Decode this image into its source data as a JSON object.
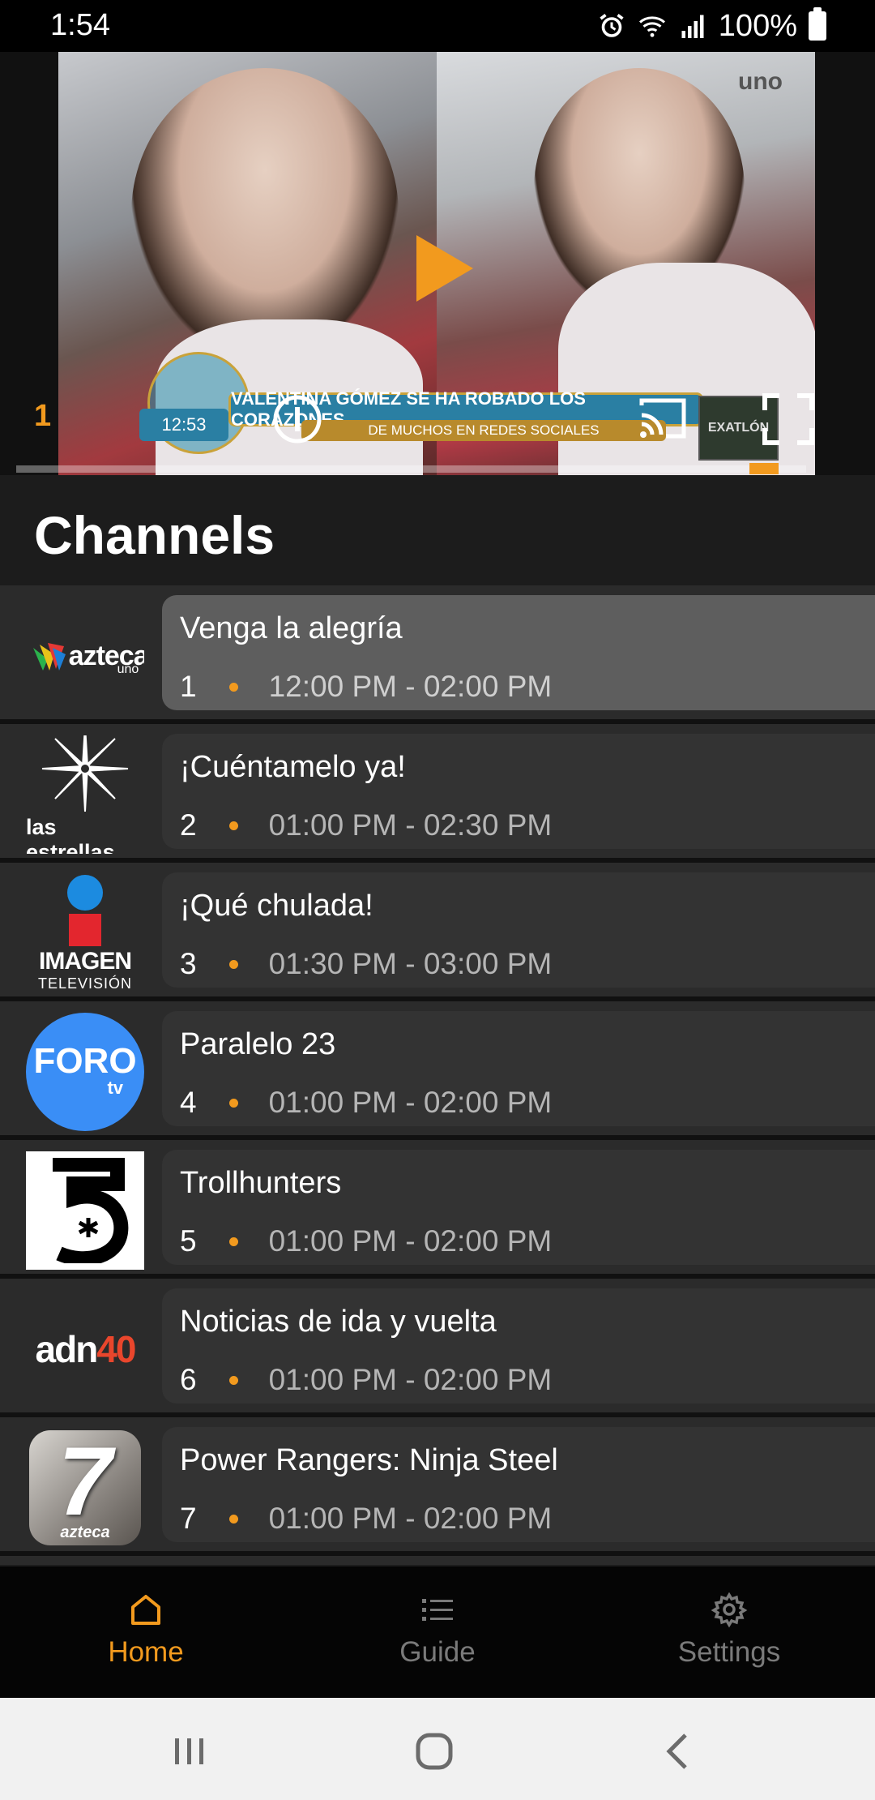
{
  "status_bar": {
    "time": "1:54",
    "battery_percent": "100%",
    "icons": [
      "alarm-icon",
      "wifi-icon",
      "signal-icon",
      "battery-icon"
    ]
  },
  "player": {
    "current_channel_number": "1",
    "progress": 0.965,
    "accent_color": "#f29a1e",
    "video_overlays": {
      "banner": "VALENTINA GÓMEZ SE HA ROBADO LOS CORAZONES",
      "banner_sub": "DE MUCHOS EN REDES SOCIALES",
      "clock": "12:53",
      "corner_logo": "uno",
      "promo": "EXATLÓN"
    }
  },
  "channels": {
    "title": "Channels",
    "items": [
      {
        "number": "1",
        "program": "Venga la alegría",
        "time": "12:00 PM - 02:00 PM",
        "logo": "azteca-uno-logo",
        "logo_text": "azteca",
        "logo_subtext": "uno",
        "active": true
      },
      {
        "number": "2",
        "program": "¡Cuéntamelo ya!",
        "time": "01:00 PM - 02:30 PM",
        "logo": "las-estrellas-logo",
        "logo_text": "las estrellas",
        "active": false
      },
      {
        "number": "3",
        "program": "¡Qué chulada!",
        "time": "01:30 PM - 03:00 PM",
        "logo": "imagen-television-logo",
        "logo_text": "IMAGEN",
        "logo_subtext": "TELEVISIÓN",
        "active": false
      },
      {
        "number": "4",
        "program": "Paralelo 23",
        "time": "01:00 PM - 02:00 PM",
        "logo": "foro-tv-logo",
        "logo_text": "FORO",
        "logo_subtext": "tv",
        "active": false
      },
      {
        "number": "5",
        "program": "Trollhunters",
        "time": "01:00 PM - 02:00 PM",
        "logo": "canal-5-logo",
        "active": false
      },
      {
        "number": "6",
        "program": "Noticias de ida y vuelta",
        "time": "01:00 PM - 02:00 PM",
        "logo": "adn40-logo",
        "logo_text": "adn",
        "logo_subtext": "40",
        "active": false
      },
      {
        "number": "7",
        "program": "Power Rangers: Ninja Steel",
        "time": "01:00 PM - 02:00 PM",
        "logo": "azteca-7-logo",
        "logo_text": "7",
        "logo_subtext": "azteca",
        "active": false
      }
    ]
  },
  "bottom_nav": {
    "items": [
      {
        "label": "Home",
        "icon": "home-icon",
        "selected": true
      },
      {
        "label": "Guide",
        "icon": "list-icon",
        "selected": false
      },
      {
        "label": "Settings",
        "icon": "gear-icon",
        "selected": false
      }
    ]
  },
  "system_nav": [
    "recent-apps-icon",
    "home-circle-icon",
    "back-icon"
  ]
}
